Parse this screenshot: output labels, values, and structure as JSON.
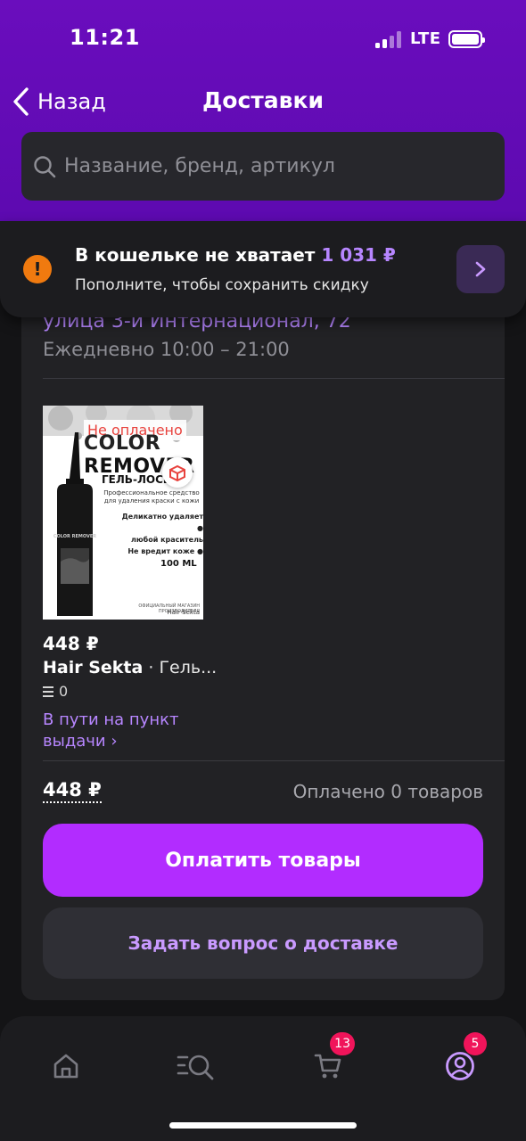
{
  "status_bar": {
    "time": "11:21",
    "network": "LTE"
  },
  "nav": {
    "back_label": "Назад",
    "title": "Доставки"
  },
  "search": {
    "placeholder": "Название, бренд, артикул"
  },
  "wallet": {
    "title": "В кошельке не хватает",
    "amount": "1 031 ₽",
    "subtitle": "Пополните, чтобы сохранить скидку",
    "alert_glyph": "!",
    "icon": "alert-icon",
    "accent": "#f07a0f"
  },
  "pickup": {
    "address": "улица 3-й Интернационал, 72",
    "hours": "Ежедневно 10:00 – 21:00"
  },
  "item": {
    "badge": "Не оплачено",
    "price": "448 ₽",
    "brand": "Hair Sekta",
    "name": " · Гель...",
    "quantity": "0",
    "status": "В пути на пункт выдачи ›",
    "package": {
      "title1": "COLOR",
      "title2": "REMOVER",
      "subtitle": "ГЕЛЬ-ЛОСЬОН",
      "description": "Профессиональное средство для удаления краски с кожи",
      "bullets": [
        "Деликатно удаляет ●",
        "любой краситель",
        "Не вредит коже ●"
      ],
      "volume": "100 ML",
      "footer": "ОФИЦИАЛЬНЫЙ МАГАЗИН ПРОИЗВОДИТЕЛЯ",
      "footer_brand": "Hair Sekta",
      "bottle_label": "COLOR REMOVER"
    }
  },
  "summary": {
    "total": "448 ₽",
    "paid_info": "Оплачено 0 товаров"
  },
  "actions": {
    "pay_label": "Оплатить товары",
    "ask_label": "Задать вопрос о доставке"
  },
  "tabbar": {
    "items": [
      {
        "name": "home",
        "icon": "home-icon"
      },
      {
        "name": "catalog",
        "icon": "catalog-search-icon"
      },
      {
        "name": "cart",
        "icon": "cart-icon",
        "badge": "13"
      },
      {
        "name": "profile",
        "icon": "profile-icon",
        "badge": "5"
      }
    ]
  },
  "colors": {
    "header": "#6a0dbd",
    "accent": "#b22cff",
    "link": "#b786ff",
    "badge": "#f0145a",
    "background": "#141416",
    "card": "#222225"
  }
}
